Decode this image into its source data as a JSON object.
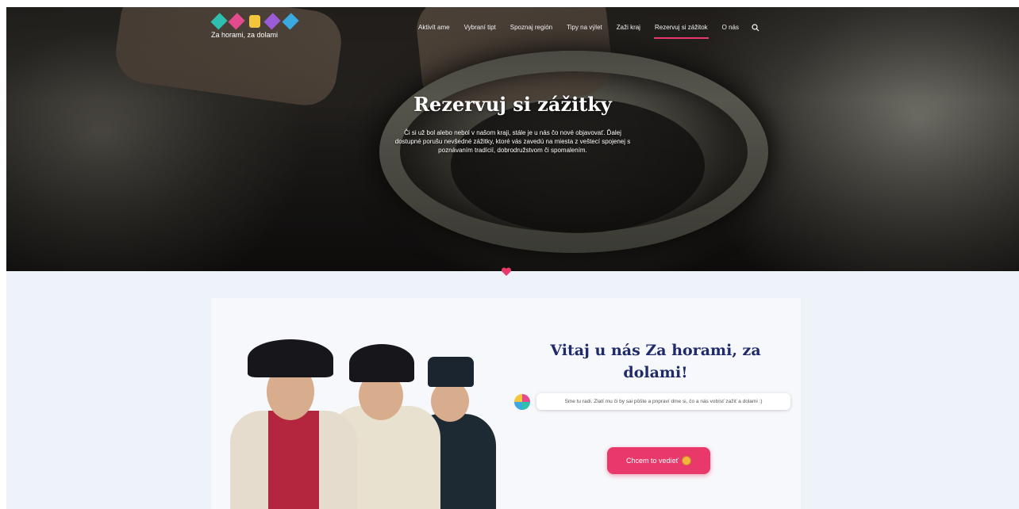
{
  "brand": {
    "name": "Za horami, za dolami",
    "colors": {
      "accent": "#e8396a",
      "teal": "#2ebfae",
      "yellow": "#f2c53d",
      "purple": "#9a5bd6",
      "blue": "#39a9e0",
      "navy": "#1f2a6b"
    }
  },
  "nav": {
    "items": [
      {
        "label": "Aktivít ame",
        "active": false
      },
      {
        "label": "Vybraní tipt",
        "active": false
      },
      {
        "label": "Spoznaj región",
        "active": false
      },
      {
        "label": "Tipy na výlet",
        "active": false
      },
      {
        "label": "Zaži kraj",
        "active": false
      },
      {
        "label": "Rezervuj si zážitok",
        "active": true
      },
      {
        "label": "O nás",
        "active": false
      }
    ],
    "search_icon": "search-icon"
  },
  "hero": {
    "title": "Rezervuj si zážitky",
    "text": "Či si už bol alebo nebol v našom kraji, stále je u nás čo nové objavovať. Ďalej dostupné porušu nevšedné zážitky, ktoré vás zavedú na miesta z veštecí spojenej s poznávaním tradícií, dobrodružstvom či spomalením."
  },
  "welcome": {
    "title": "Vitaj u nás Za horami, za dolami!",
    "message": "Sme tu radi. Zlatí mu či by sai pôšte a pnpraví dme si, čo a nás vobísť zažiť a dolami :)",
    "cta_label": "Chcem to vedieť",
    "cta_icon": "smiley-icon"
  }
}
